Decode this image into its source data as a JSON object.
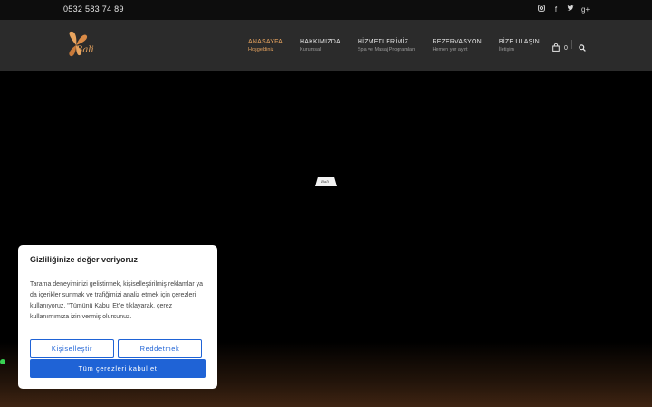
{
  "topbar": {
    "phone": "0532 583 74 89",
    "social": [
      {
        "icon": "instagram-icon"
      },
      {
        "icon": "facebook-icon",
        "glyph": "f"
      },
      {
        "icon": "twitter-icon"
      },
      {
        "icon": "google-plus-icon",
        "glyph": "g+"
      }
    ]
  },
  "header": {
    "logo_text": "Bali",
    "nav": [
      {
        "label": "ANASAYFA",
        "sub": "Hoşgeldiniz",
        "active": true
      },
      {
        "label": "HAKKIMIZDA",
        "sub": "Kurumsal"
      },
      {
        "label": "HİZMETLERİMİZ",
        "sub": "Spa ve Masaj Programları"
      },
      {
        "label": "REZERVASYON",
        "sub": "Hemen yer ayırt"
      },
      {
        "label": "BİZE ULAŞIN",
        "sub": "İletişim"
      }
    ],
    "cart_count": "0"
  },
  "cookie": {
    "title": "Gizliliğinize değer veriyoruz",
    "body": "Tarama deneyiminizi geliştirmek, kişiselleştirilmiş reklamlar ya da içerikler sunmak ve trafiğimizi analiz etmek için çerezleri kullanıyoruz. \"Tümünü Kabul Et\"e tıklayarak, çerez kullanımımıza izin vermiş olursunuz.",
    "customize": "Kişiselleştir",
    "reject": "Reddetmek",
    "accept": "Tüm çerezleri kabul et"
  },
  "colors": {
    "accent": "#e8a45f",
    "button_blue": "#1f63d6",
    "status_dot": "#39d353"
  }
}
